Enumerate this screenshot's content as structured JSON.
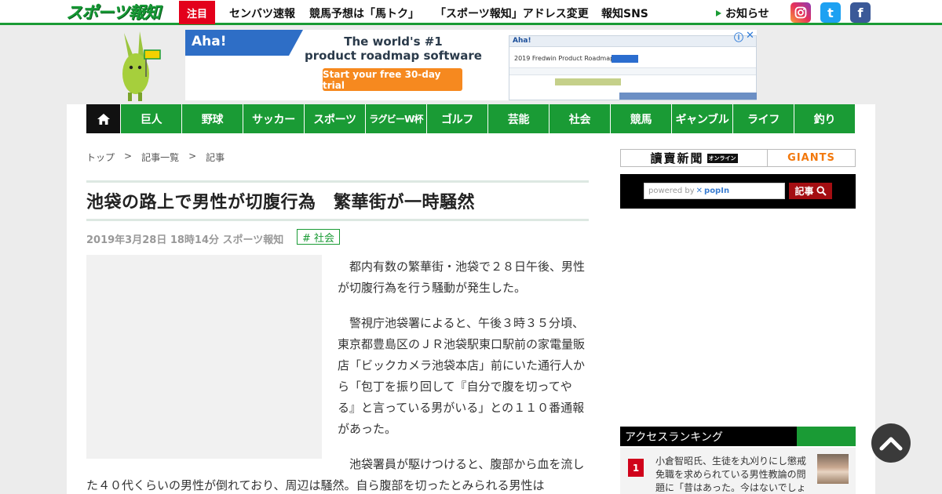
{
  "header": {
    "logo_text": "スポーツ報知",
    "chumoku_label": "注目",
    "links": [
      "センバツ速報",
      "競馬予想は「馬トク」",
      "「スポーツ報知」アドレス変更",
      "報知SNS"
    ],
    "news_label": "お知らせ",
    "sns": {
      "twitter_glyph": "t",
      "facebook_glyph": "f"
    },
    "accent_color": "#1a9b35"
  },
  "ad": {
    "brand": "Aha!",
    "headline_1": "The world's #1",
    "headline_2": "product roadmap software",
    "cta": "Start your free 30-day trial",
    "shot_brand": "Aha!",
    "shot_title": "2019 Fredwin Product Roadmap"
  },
  "nav": {
    "items": [
      "巨人",
      "野球",
      "サッカー",
      "スポーツ",
      "ラグビーW杯",
      "ゴルフ",
      "芸能",
      "社会",
      "競馬",
      "ギャンブル",
      "ライフ",
      "釣り"
    ]
  },
  "breadcrumb": [
    "トップ",
    ">",
    "記事一覧",
    ">",
    "記事"
  ],
  "article": {
    "title": "池袋の路上で男性が切腹行為　繁華街が一時騒然",
    "meta": "2019年3月28日 18時14分  スポーツ報知",
    "category": "# 社会",
    "paragraphs": [
      "都内有数の繁華街・池袋で２８日午後、男性が切腹行為を行う騒動が発生した。",
      "警視庁池袋署によると、午後３時３５分頃、東京都豊島区のＪＲ池袋駅東口駅前の家電量販店「ビックカメラ池袋本店」前にいた通行人から「包丁を振り回して『自分で腹を切ってやる』と言っている男がいる」との１１０番通報があった。",
      "池袋署員が駆けつけると、腹部から血を流した４０代くらいの男性が倒れており、周辺は騒然。自ら腹部を切ったとみられる男性は"
    ]
  },
  "sidebar": {
    "yomiuri": "讀賣新聞",
    "online_badge": "オンライン",
    "giants": "GIANTS",
    "search_placeholder_prefix": "powered by",
    "search_placeholder_brand": "popIn",
    "search_button": "記事",
    "ranking_title": "アクセスランキング",
    "ranking": [
      {
        "rank": "1",
        "text": "小倉智昭氏、生徒を丸刈りにし懲戒免職を求められている男性教論の問題に「昔はあった。今はないでしょ"
      }
    ]
  }
}
